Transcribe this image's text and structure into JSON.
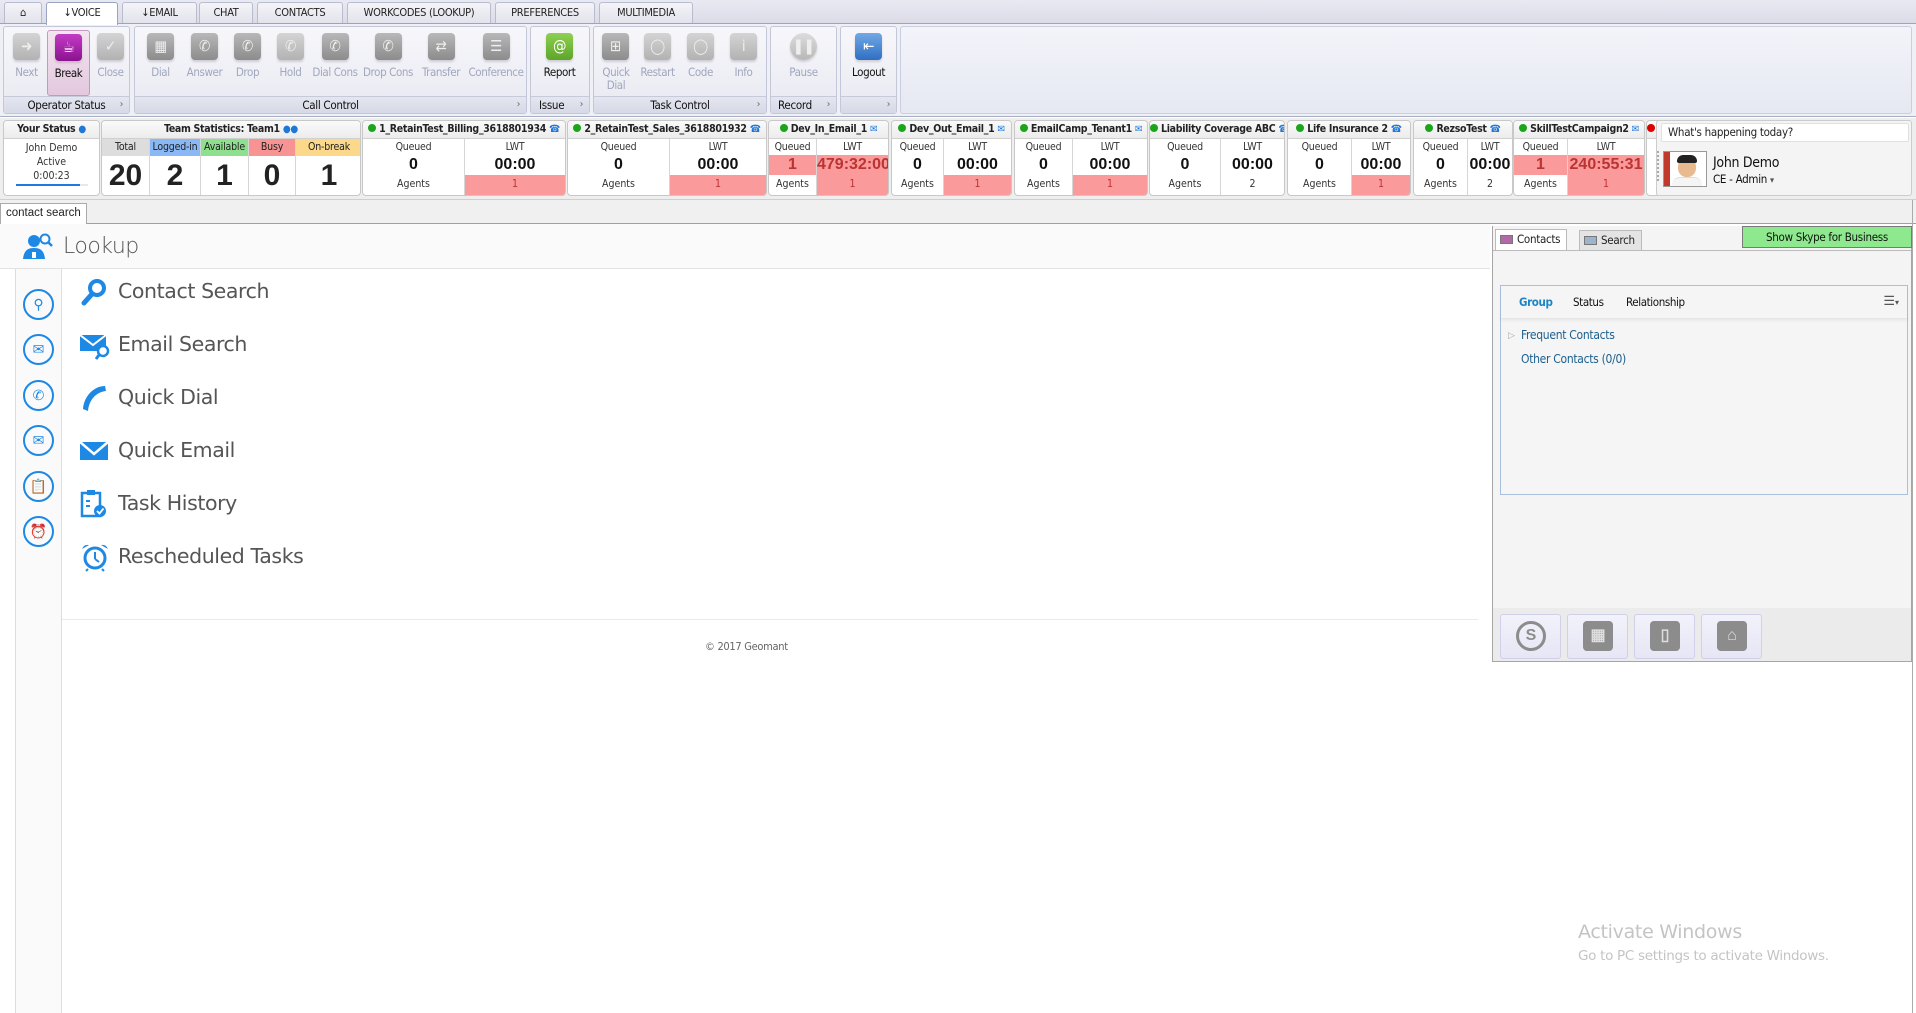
{
  "top_tabs": [
    {
      "label": "",
      "icon": "home-icon"
    },
    {
      "label": "VOICE",
      "icon": "phone-icon",
      "active": true
    },
    {
      "label": "EMAIL",
      "icon": "phone-icon"
    },
    {
      "label": "CHAT"
    },
    {
      "label": "CONTACTS"
    },
    {
      "label": "WORKCODES (LOOKUP)"
    },
    {
      "label": "PREFERENCES"
    },
    {
      "label": "MULTIMEDIA"
    }
  ],
  "ribbon": {
    "groups": [
      {
        "label": "Operator Status",
        "buttons": [
          {
            "label": "Next",
            "enabled": false
          },
          {
            "label": "Break",
            "enabled": true,
            "selected": true
          },
          {
            "label": "Close",
            "enabled": false
          }
        ]
      },
      {
        "label": "Call Control",
        "buttons": [
          {
            "label": "Dial",
            "enabled": false
          },
          {
            "label": "Answer",
            "enabled": false
          },
          {
            "label": "Drop",
            "enabled": false
          },
          {
            "label": "Hold",
            "enabled": false
          },
          {
            "label": "Dial Cons",
            "enabled": false
          },
          {
            "label": "Drop Cons",
            "enabled": false
          },
          {
            "label": "Transfer",
            "enabled": false
          },
          {
            "label": "Conference",
            "enabled": false
          }
        ]
      },
      {
        "label": "Issue",
        "buttons": [
          {
            "label": "Report",
            "enabled": true
          }
        ]
      },
      {
        "label": "Task Control",
        "buttons": [
          {
            "label": "Quick Dial",
            "enabled": false
          },
          {
            "label": "Restart",
            "enabled": false
          },
          {
            "label": "Code",
            "enabled": false
          },
          {
            "label": "Info",
            "enabled": false
          }
        ]
      },
      {
        "label": "Record",
        "buttons": [
          {
            "label": "Pause",
            "enabled": false
          }
        ]
      },
      {
        "label": "",
        "buttons": [
          {
            "label": "Logout",
            "enabled": true
          }
        ]
      }
    ],
    "more_glyph": "›"
  },
  "your_status": {
    "title": "Your Status",
    "name": "John Demo",
    "state": "Active",
    "timer": "0:00:23"
  },
  "team_stats": {
    "title": "Team Statistics: Team1",
    "columns": [
      {
        "label": "Total",
        "value": "20",
        "color": "#dddddd"
      },
      {
        "label": "Logged-in",
        "value": "2",
        "color": "#8ab8f5"
      },
      {
        "label": "Available",
        "value": "1",
        "color": "#8ee08e"
      },
      {
        "label": "Busy",
        "value": "0",
        "color": "#f79393"
      },
      {
        "label": "On-break",
        "value": "1",
        "color": "#fbd88a"
      }
    ]
  },
  "queues": [
    {
      "name": "1_RetainTest_Billing_3618801934",
      "channel": "phone",
      "status": "green",
      "queued_label": "Queued",
      "queued": "0",
      "agents_label": "Agents",
      "lwt_label": "LWT",
      "lwt": "00:00",
      "agents": "1",
      "queued_alert": false,
      "agents_alert": true
    },
    {
      "name": "2_RetainTest_Sales_3618801932",
      "channel": "phone",
      "status": "green",
      "queued_label": "Queued",
      "queued": "0",
      "agents_label": "Agents",
      "lwt_label": "LWT",
      "lwt": "00:00",
      "agents": "1",
      "queued_alert": false,
      "agents_alert": true
    },
    {
      "name": "Dev_In_Email_1",
      "channel": "email",
      "status": "green",
      "queued_label": "Queued",
      "queued": "1",
      "agents_label": "Agents",
      "lwt_label": "LWT",
      "lwt": "479:32:00",
      "agents": "1",
      "queued_alert": true,
      "agents_alert": true
    },
    {
      "name": "Dev_Out_Email_1",
      "channel": "email",
      "status": "green",
      "queued_label": "Queued",
      "queued": "0",
      "agents_label": "Agents",
      "lwt_label": "LWT",
      "lwt": "00:00",
      "agents": "1",
      "queued_alert": false,
      "agents_alert": true
    },
    {
      "name": "EmailCamp_Tenant1",
      "channel": "email",
      "status": "green",
      "queued_label": "Queued",
      "queued": "0",
      "agents_label": "Agents",
      "lwt_label": "LWT",
      "lwt": "00:00",
      "agents": "1",
      "queued_alert": false,
      "agents_alert": true
    },
    {
      "name": "Liability Coverage ABC",
      "channel": "phone",
      "status": "green",
      "queued_label": "Queued",
      "queued": "0",
      "agents_label": "Agents",
      "lwt_label": "LWT",
      "lwt": "00:00",
      "agents": "2",
      "queued_alert": false,
      "agents_alert": false
    },
    {
      "name": "Life Insurance 2",
      "channel": "phone",
      "status": "green",
      "queued_label": "Queued",
      "queued": "0",
      "agents_label": "Agents",
      "lwt_label": "LWT",
      "lwt": "00:00",
      "agents": "1",
      "queued_alert": false,
      "agents_alert": true
    },
    {
      "name": "RezsoTest",
      "channel": "phone",
      "status": "green",
      "queued_label": "Queued",
      "queued": "0",
      "agents_label": "Agents",
      "lwt_label": "LWT",
      "lwt": "00:00",
      "agents": "2",
      "queued_alert": false,
      "agents_alert": false
    },
    {
      "name": "SkillTestCampaign2",
      "channel": "email",
      "status": "green",
      "queued_label": "Queued",
      "queued": "1",
      "agents_label": "Agents",
      "lwt_label": "LWT",
      "lwt": "240:55:31",
      "agents": "1",
      "queued_alert": true,
      "agents_alert": true
    }
  ],
  "social": {
    "prompt": "What's happening today?",
    "name": "John Demo",
    "role": "CE - Admin",
    "dropdown_glyph": "▾"
  },
  "doc_tab": "contact search",
  "lookup": {
    "title": "Lookup",
    "items": [
      {
        "label": "Contact Search",
        "icon": "search-icon"
      },
      {
        "label": "Email Search",
        "icon": "email-search-icon"
      },
      {
        "label": "Quick Dial",
        "icon": "phone-icon"
      },
      {
        "label": "Quick Email",
        "icon": "email-icon"
      },
      {
        "label": "Task History",
        "icon": "clipboard-check-icon"
      },
      {
        "label": "Rescheduled Tasks",
        "icon": "alarm-clock-icon"
      }
    ],
    "copyright": "© 2017 Geomant"
  },
  "contacts_pane": {
    "tabs": [
      "Contacts",
      "Search"
    ],
    "skype_button": "Show Skype for Business",
    "filters": [
      "Group",
      "Status",
      "Relationship"
    ],
    "active_filter": "Group",
    "groups": [
      "Frequent Contacts",
      "Other Contacts (0/0)"
    ],
    "bottom_buttons": [
      "skype-icon",
      "desk-phone-icon",
      "mobile-phone-icon",
      "home-icon"
    ]
  },
  "watermark": {
    "title": "Activate Windows",
    "subtitle": "Go to PC settings to activate Windows."
  }
}
